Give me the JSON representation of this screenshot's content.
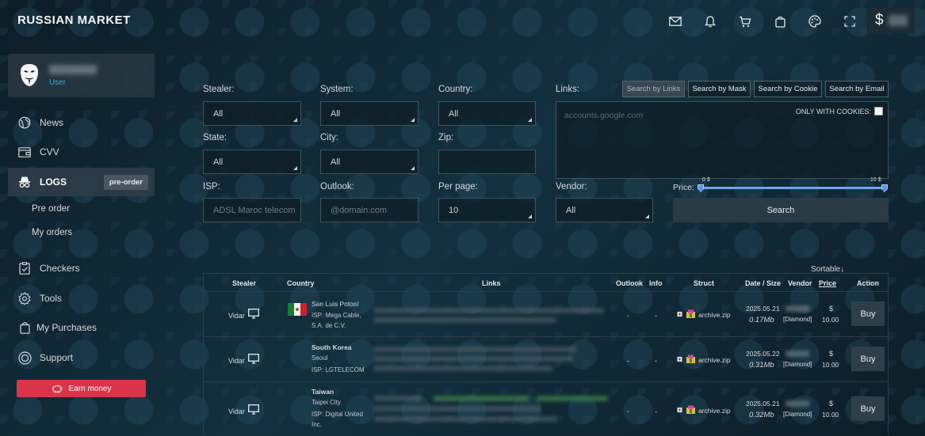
{
  "brand": "RUSSIAN MARKET",
  "topbar": {
    "icons": [
      "mail-icon",
      "bell-icon",
      "cart-icon",
      "bag-icon",
      "palette-icon",
      "fullscreen-icon"
    ],
    "balance_symbol": "$"
  },
  "user": {
    "role": "User"
  },
  "nav": {
    "news": "News",
    "cvv": "CVV",
    "logs": "LOGS",
    "logs_badge": "pre-order",
    "pre_order": "Pre order",
    "my_orders": "My orders",
    "checkers": "Checkers",
    "tools": "Tools",
    "purchases": "My Purchases",
    "support": "Support",
    "earn": "Earn money"
  },
  "filters": {
    "stealer_label": "Stealer:",
    "stealer_value": "All",
    "system_label": "System:",
    "system_value": "All",
    "country_label": "Country:",
    "country_value": "All",
    "state_label": "State:",
    "state_value": "All",
    "city_label": "City:",
    "city_value": "All",
    "zip_label": "Zip:",
    "zip_value": "",
    "isp_label": "ISP:",
    "isp_placeholder": "ADSL Maroc telecom",
    "outlook_label": "Outlook:",
    "outlook_placeholder": "@domain.com",
    "perpage_label": "Per page:",
    "perpage_value": "10",
    "vendor_label": "Vendor:",
    "vendor_value": "All",
    "links_label": "Links:",
    "links_placeholder": "accounts.google.com",
    "only_cookies": "ONLY WITH COOKIES:",
    "search_links": "Search by Links",
    "search_mask": "Search by Mask",
    "search_cookie": "Search by Cookie",
    "search_email": "Search by Email",
    "price_label": "Price:",
    "price_min": "0 $",
    "price_max": "10 $",
    "search_button": "Search"
  },
  "table": {
    "sortable": "Sortable↓",
    "headers": {
      "stealer": "Stealer",
      "country": "Country",
      "links": "Links",
      "outlook": "Outlook",
      "info": "Info",
      "struct": "Struct",
      "date_size": "Date / Size",
      "vendor": "Vendor",
      "price": "Price",
      "action": "Action"
    },
    "rows": [
      {
        "stealer": "Vidar",
        "location": "San Luis Potosí",
        "isp1": "ISP: Mega Cable,",
        "isp2": "S.A. de C.V.",
        "outlook": "-",
        "info": "-",
        "struct": "archive.zip",
        "date": "2025.05.21",
        "size": "0.17Mb",
        "vendor": "[Diamond]",
        "currency": "$",
        "price": "10.00",
        "action": "Buy"
      },
      {
        "stealer": "Vidar",
        "location": "South Korea",
        "city": "Seoul",
        "isp1": "ISP: LGTELECOM",
        "outlook": "-",
        "info": "-",
        "struct": "archive.zip",
        "date": "2025.05.22",
        "size": "0.31Mb",
        "vendor": "[Diamond]",
        "currency": "$",
        "price": "10.00",
        "action": "Buy"
      },
      {
        "stealer": "Vidar",
        "location": "Taiwan",
        "city": "Taipei City",
        "isp1": "ISP: Digital United",
        "isp2": "Inc.",
        "outlook": "-",
        "info": "-",
        "struct": "archive.zip",
        "date": "2025.05.21",
        "size": "0.32Mb",
        "vendor": "[Diamond]",
        "currency": "$",
        "price": "10.00",
        "action": "Buy"
      }
    ]
  }
}
